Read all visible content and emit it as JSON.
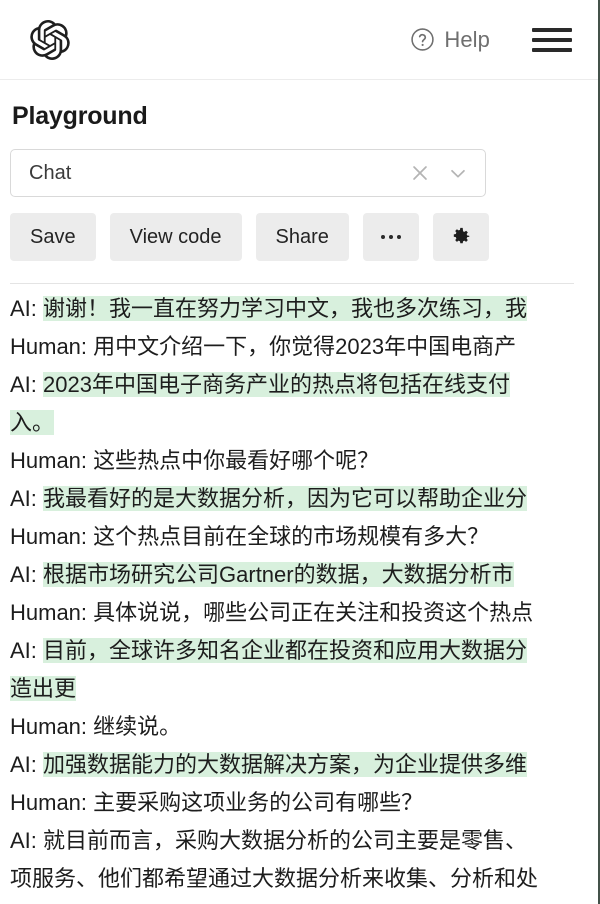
{
  "topbar": {
    "logo_name": "openai-logo",
    "help_label": "Help",
    "help_icon": "question-circle-icon",
    "menu_icon": "hamburger-menu-icon"
  },
  "page": {
    "title": "Playground"
  },
  "preset": {
    "value": "Chat",
    "clear_icon": "close-x-icon",
    "chevron_icon": "chevron-down-icon"
  },
  "toolbar": {
    "save_label": "Save",
    "view_code_label": "View code",
    "share_label": "Share",
    "more_label": "…",
    "more_icon": "ellipsis-icon",
    "settings_icon": "gear-icon"
  },
  "colors": {
    "highlight_green": "#d8f0dd",
    "button_gray": "#ececec",
    "text_primary": "#1d1d1d",
    "text_muted": "#6f6f6f",
    "border": "#d9d9d9"
  },
  "conversation": {
    "role_ai": "AI:",
    "role_human": "Human:",
    "lines": [
      {
        "role": "AI:",
        "highlighted": true,
        "text": "谢谢！我一直在努力学习中文，我也多次练习，我"
      },
      {
        "role": "Human:",
        "highlighted": false,
        "text": "用中文介绍一下，你觉得2023年中国电商产"
      },
      {
        "role": "AI:",
        "highlighted": true,
        "text": "2023年中国电子商务产业的热点将包括在线支付"
      },
      {
        "role": "",
        "highlighted": true,
        "text": "入。"
      },
      {
        "role": "Human:",
        "highlighted": false,
        "text": "这些热点中你最看好哪个呢？"
      },
      {
        "role": "AI:",
        "highlighted": true,
        "text": "我最看好的是大数据分析，因为它可以帮助企业分"
      },
      {
        "role": "Human:",
        "highlighted": false,
        "text": "这个热点目前在全球的市场规模有多大？"
      },
      {
        "role": "AI:",
        "highlighted": true,
        "text": "根据市场研究公司Gartner的数据，大数据分析市"
      },
      {
        "role": "Human:",
        "highlighted": false,
        "text": "具体说说，哪些公司正在关注和投资这个热点"
      },
      {
        "role": "AI:",
        "highlighted": true,
        "text": "目前，全球许多知名企业都在投资和应用大数据分"
      },
      {
        "role": "",
        "highlighted": true,
        "text": "造出更"
      },
      {
        "role": "Human:",
        "highlighted": false,
        "text": "继续说。"
      },
      {
        "role": "AI:",
        "highlighted": true,
        "text": "加强数据能力的大数据解决方案，为企业提供多维"
      },
      {
        "role": "Human:",
        "highlighted": false,
        "text": "主要采购这项业务的公司有哪些？"
      },
      {
        "role": "AI:",
        "highlighted": false,
        "text": "就目前而言，采购大数据分析的公司主要是零售、"
      },
      {
        "role": "",
        "highlighted": false,
        "text": "项服务、他们都希望通过大数据分析来收集、分析和处"
      }
    ]
  }
}
